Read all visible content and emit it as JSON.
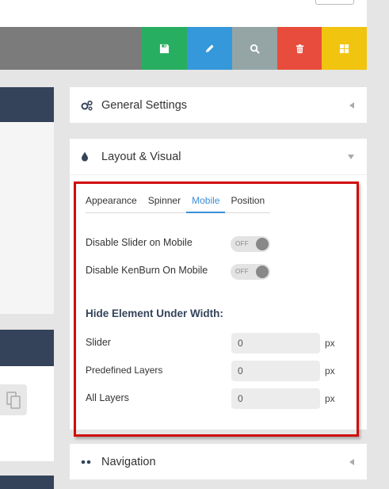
{
  "toolbar": {
    "buttons": [
      {
        "name": "save",
        "color": "#27ae60"
      },
      {
        "name": "edit",
        "color": "#3498db"
      },
      {
        "name": "preview",
        "color": "#95a5a6"
      },
      {
        "name": "delete",
        "color": "#e74c3c"
      },
      {
        "name": "layouts",
        "color": "#f1c40f"
      }
    ]
  },
  "panels": {
    "general": {
      "title": "General Settings",
      "icon": "gears-icon"
    },
    "layout": {
      "title": "Layout & Visual",
      "icon": "droplet-icon"
    },
    "navigation": {
      "title": "Navigation",
      "icon": "dots-icon"
    }
  },
  "tabs": [
    "Appearance",
    "Spinner",
    "Mobile",
    "Position"
  ],
  "active_tab": "Mobile",
  "mobile": {
    "disable_slider_label": "Disable Slider on Mobile",
    "disable_slider_state": "OFF",
    "disable_kenburn_label": "Disable KenBurn On Mobile",
    "disable_kenburn_state": "OFF",
    "hide_title": "Hide Element Under Width:",
    "fields": [
      {
        "label": "Slider",
        "value": "0",
        "unit": "px"
      },
      {
        "label": "Predefined Layers",
        "value": "0",
        "unit": "px"
      },
      {
        "label": "All Layers",
        "value": "0",
        "unit": "px"
      }
    ]
  },
  "colors": {
    "accent": "#3b8ed7",
    "highlight_border": "#cf0a0a",
    "panel_header": "#34435a"
  }
}
